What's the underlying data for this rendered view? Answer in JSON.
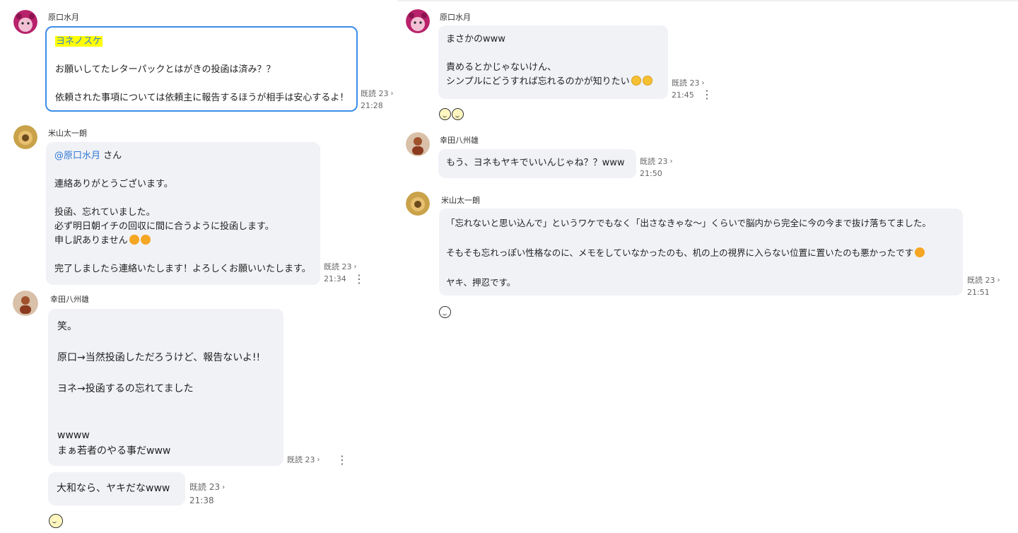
{
  "colors": {
    "bubble_bg": "#f1f2f6",
    "mention": "#2f78d6",
    "highlight_bg": "#ffff00",
    "focus_border": "#3c8ee8"
  },
  "left": {
    "m1": {
      "sender": "原口水月",
      "highlight_name": "ヨネノスケ",
      "line1": "お願いしてたレターパックとはがきの投函は済み？？",
      "line2": "依頼された事項については依頼主に報告するほうが相手は安心するよ！",
      "read": "既読 23",
      "time": "21:28"
    },
    "m2": {
      "sender": "米山太一朗",
      "mention": "@原口水月",
      "mention_suffix": " さん",
      "line1": "連絡ありがとうございます。",
      "line2": "投函、忘れていました。",
      "line3": "必ず明日朝イチの回収に間に合うように投函します。",
      "line4": "申し訳ありません",
      "line5": "完了しましたら連絡いたします！よろしくお願いいたします。",
      "read": "既読 23",
      "time": "21:34"
    },
    "m3": {
      "sender": "幸田八州雄",
      "line1": "笑。",
      "line2": "原口→当然投函しただろうけど、報告ないよ!!",
      "line3": "ヨネ→投函するの忘れてました",
      "line4": "wwww",
      "line5": "まぁ若者のやる事だwww",
      "read": "既読 23"
    },
    "m4": {
      "text": "大和なら、ヤキだなwww",
      "read": "既読 23",
      "time": "21:38"
    }
  },
  "right": {
    "m1": {
      "sender": "原口水月",
      "line1": "まさかのwww",
      "line2": "責めるとかじゃないけん、",
      "line3": "シンプルにどうすれば忘れるのかが知りたい",
      "read": "既読 23",
      "time": "21:45"
    },
    "m2": {
      "sender": "幸田八州雄",
      "text": "もう、ヨネもヤキでいいんじゃね？？www",
      "read": "既読 23",
      "time": "21:50"
    },
    "m3": {
      "sender": "米山太一朗",
      "line1": "「忘れないと思い込んで」というワケでもなく「出さなきゃな～」くらいで脳内から完全に今の今まで抜け落ちてました。",
      "line2": "そもそも忘れっぽい性格なのに、メモをしていなかったのも、机の上の視界に入らない位置に置いたのも悪かったです",
      "line3": "ヤキ、押忍です。",
      "read": "既読 23",
      "time": "21:51"
    }
  }
}
